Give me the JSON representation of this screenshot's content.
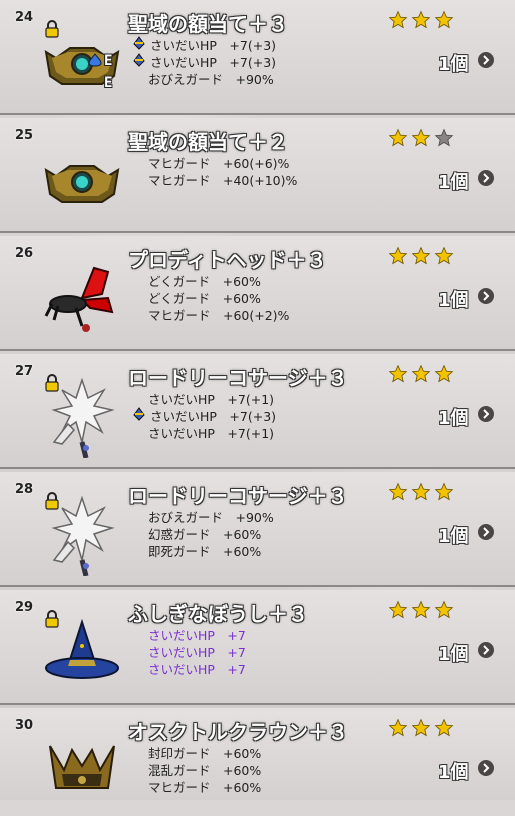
{
  "items": [
    {
      "num": "24",
      "name": "聖域の額当て＋３",
      "stars": [
        true,
        true,
        true
      ],
      "count": "1個",
      "stats": [
        {
          "text": "さいだいHP　+7(+3)",
          "badge": true
        },
        {
          "text": "さいだいHP　+7(+3)",
          "badge": true
        },
        {
          "text": "おびえガード　+90%",
          "badge": false
        }
      ]
    },
    {
      "num": "25",
      "name": "聖域の額当て＋２",
      "stars": [
        true,
        true,
        false
      ],
      "count": "1個",
      "stats": [
        {
          "text": "マヒガード　+60(+6)%",
          "badge": false
        },
        {
          "text": "マヒガード　+40(+10)%",
          "badge": false
        }
      ]
    },
    {
      "num": "26",
      "name": "プロディトヘッド＋３",
      "stars": [
        true,
        true,
        true
      ],
      "count": "1個",
      "stats": [
        {
          "text": "どくガード　+60%",
          "badge": false
        },
        {
          "text": "どくガード　+60%",
          "badge": false
        },
        {
          "text": "マヒガード　+60(+2)%",
          "badge": false
        }
      ]
    },
    {
      "num": "27",
      "name": "ロードリーコサージ＋３",
      "stars": [
        true,
        true,
        true
      ],
      "count": "1個",
      "stats": [
        {
          "text": "さいだいHP　+7(+1)",
          "badge": false
        },
        {
          "text": "さいだいHP　+7(+3)",
          "badge": true
        },
        {
          "text": "さいだいHP　+7(+1)",
          "badge": false
        }
      ]
    },
    {
      "num": "28",
      "name": "ロードリーコサージ＋３",
      "stars": [
        true,
        true,
        true
      ],
      "count": "1個",
      "stats": [
        {
          "text": "おびえガード　+90%",
          "badge": false
        },
        {
          "text": "幻惑ガード　+60%",
          "badge": false
        },
        {
          "text": "即死ガード　+60%",
          "badge": false
        }
      ]
    },
    {
      "num": "29",
      "name": "ふしぎなぼうし＋３",
      "stars": [
        true,
        true,
        true
      ],
      "count": "1個",
      "stats": [
        {
          "text": "さいだいHP　+7",
          "badge": false,
          "purple": true
        },
        {
          "text": "さいだいHP　+7",
          "badge": false,
          "purple": true
        },
        {
          "text": "さいだいHP　+7",
          "badge": false,
          "purple": true
        }
      ]
    },
    {
      "num": "30",
      "name": "オスクトルクラウン＋３",
      "stars": [
        true,
        true,
        true
      ],
      "count": "1個",
      "stats": [
        {
          "text": "封印ガード　+60%",
          "badge": false
        },
        {
          "text": "混乱ガード　+60%",
          "badge": false
        },
        {
          "text": "マヒガード　+60%",
          "badge": false
        }
      ]
    }
  ],
  "item24_marks": [
    "E",
    "E"
  ],
  "icons": {
    "24": "crown-circlet-icon",
    "25": "crown-circlet-icon",
    "26": "insect-helm-icon",
    "27": "white-corsage-icon",
    "28": "white-corsage-icon",
    "29": "wizard-hat-icon",
    "30": "dark-crown-icon"
  },
  "colors": {
    "star_on": "#f2c400",
    "star_off": "#8a8584",
    "purple_text": "#7b2fd0",
    "name_outline": "#333333"
  }
}
